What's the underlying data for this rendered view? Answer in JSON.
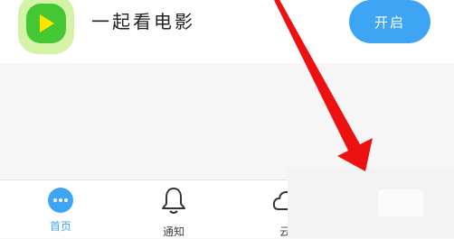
{
  "app_row": {
    "icon": "play-icon",
    "name": "一起看电影",
    "button_label": "开启"
  },
  "tabs": [
    {
      "label": "首页",
      "icon": "chat-bubble-icon",
      "active": true
    },
    {
      "label": "通知",
      "icon": "bell-icon",
      "active": false
    },
    {
      "label": "云",
      "icon": "cloud-icon",
      "active": false
    }
  ],
  "colors": {
    "accent": "#3ea5f4",
    "arrow": "#ee1111",
    "app_icon_outer": "#d4f3a6",
    "app_icon_inner": "#45c734",
    "play": "#ffe300"
  }
}
